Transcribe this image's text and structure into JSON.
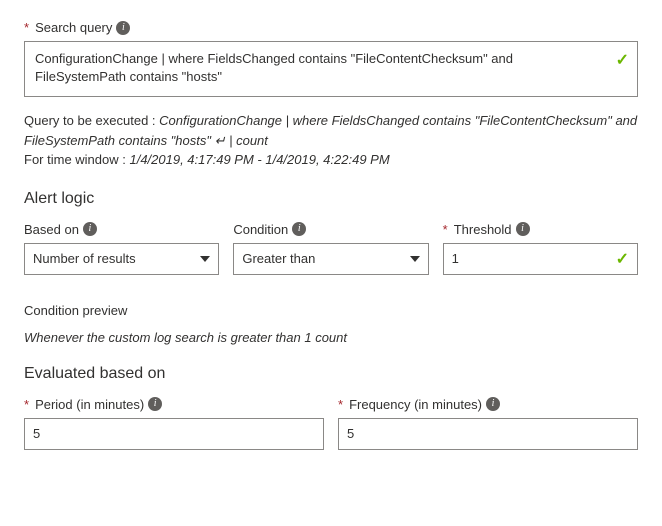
{
  "searchQuery": {
    "label": "Search query",
    "value": "ConfigurationChange | where FieldsChanged contains \"FileContentChecksum\" and FileSystemPath contains \"hosts\""
  },
  "queryPreview": {
    "prefix": "Query to be executed : ",
    "query": "ConfigurationChange | where FieldsChanged contains \"FileContentChecksum\" and FileSystemPath contains \"hosts\" ",
    "suffix": "| count",
    "timePrefix": "For time window : ",
    "timeWindow": "1/4/2019, 4:17:49 PM - 1/4/2019, 4:22:49 PM"
  },
  "alertLogic": {
    "heading": "Alert logic",
    "basedOn": {
      "label": "Based on",
      "value": "Number of results"
    },
    "condition": {
      "label": "Condition",
      "value": "Greater than"
    },
    "threshold": {
      "label": "Threshold",
      "value": "1"
    }
  },
  "conditionPreview": {
    "label": "Condition preview",
    "text": "Whenever the custom log search is greater than 1 count"
  },
  "evaluated": {
    "heading": "Evaluated based on",
    "period": {
      "label": "Period (in minutes)",
      "value": "5"
    },
    "frequency": {
      "label": "Frequency (in minutes)",
      "value": "5"
    }
  }
}
